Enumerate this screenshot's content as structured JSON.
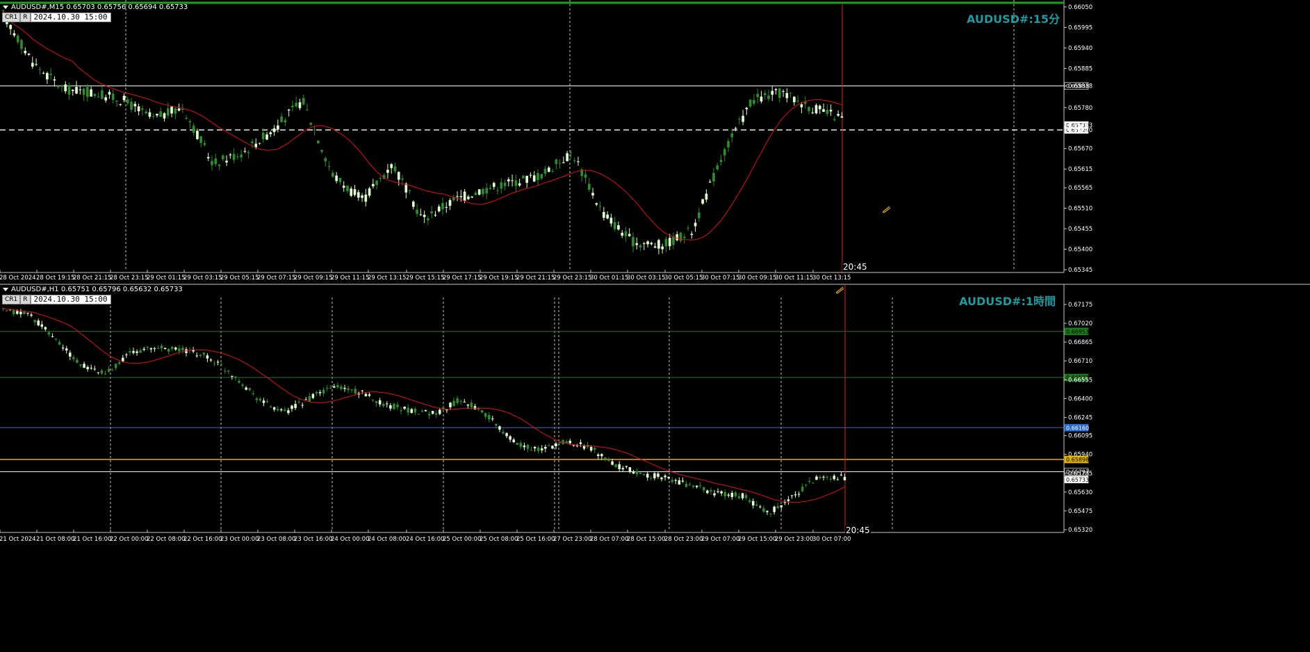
{
  "colors": {
    "background": "#000000",
    "bull_candle": "#2e8b2e",
    "bear_candle": "#e0ffd0",
    "ma_line": "#e01010",
    "grid": "#c8c8c8",
    "cursor_line": "#e02020",
    "watermark": "#1f9aa0",
    "green_level": "#1e7a1e",
    "blue_level": "#2a6ad0",
    "yellow_level": "#e0b000"
  },
  "top_pane": {
    "info_line": "AUDUSD#,M15  0.65703 0.65756 0.65694 0.65733",
    "buttons": [
      "CR1",
      "R"
    ],
    "datetime": "2024.10.30 15:00",
    "watermark": "AUDUSD#:15分",
    "price_labels": [
      "0.66050",
      "0.65995",
      "0.65940",
      "0.65885",
      "0.65838",
      "0.65780",
      "0.65733",
      "0.65720",
      "0.65670",
      "0.65615",
      "0.65565",
      "0.65510",
      "0.65455",
      "0.65400",
      "0.65345"
    ],
    "time_labels": [
      "28 Oct 2024",
      "28 Oct 19:15",
      "28 Oct 21:15",
      "28 Oct 23:15",
      "29 Oct 01:15",
      "29 Oct 03:15",
      "29 Oct 05:15",
      "29 Oct 07:15",
      "29 Oct 09:15",
      "29 Oct 11:15",
      "29 Oct 13:15",
      "29 Oct 15:15",
      "29 Oct 17:15",
      "29 Oct 19:15",
      "29 Oct 21:15",
      "29 Oct 23:15",
      "30 Oct 01:15",
      "30 Oct 03:15",
      "30 Oct 05:15",
      "30 Oct 07:15",
      "30 Oct 09:15",
      "30 Oct 11:15",
      "30 Oct 13:15"
    ],
    "cursor_time": "20:45",
    "hline_solid": "0.65838",
    "hline_dashed": "0.65720",
    "current_price": "0.65733"
  },
  "bottom_pane": {
    "info_line": "AUDUSD#,H1  0.65751 0.65796 0.65632 0.65733",
    "buttons": [
      "CR1",
      "R"
    ],
    "datetime": "2024.10.30 15:00",
    "watermark": "AUDUSD#:1時間",
    "price_labels": [
      "0.67175",
      "0.67020",
      "0.66865",
      "0.66710",
      "0.66555",
      "0.66400",
      "0.66245",
      "0.66095",
      "0.65940",
      "0.65785",
      "0.65630",
      "0.65475",
      "0.65320"
    ],
    "level_labels": {
      "green_upper": "0.66953",
      "green_lower": "0.66573",
      "blue": "0.66160",
      "yellow": "0.65898",
      "white": "0.65797",
      "current": "0.65733"
    },
    "time_labels": [
      "21 Oct 2024",
      "21 Oct 08:00",
      "21 Oct 16:00",
      "22 Oct 00:00",
      "22 Oct 08:00",
      "22 Oct 16:00",
      "23 Oct 00:00",
      "23 Oct 08:00",
      "23 Oct 16:00",
      "24 Oct 00:00",
      "24 Oct 08:00",
      "24 Oct 16:00",
      "25 Oct 00:00",
      "25 Oct 08:00",
      "25 Oct 16:00",
      "27 Oct 23:00",
      "28 Oct 07:00",
      "28 Oct 15:00",
      "28 Oct 23:00",
      "29 Oct 07:00",
      "29 Oct 15:00",
      "29 Oct 23:00",
      "30 Oct 07:00"
    ],
    "cursor_time": "20:45"
  },
  "icons": [
    "arrow-down-icon",
    "pencil-cursor-icon"
  ]
}
